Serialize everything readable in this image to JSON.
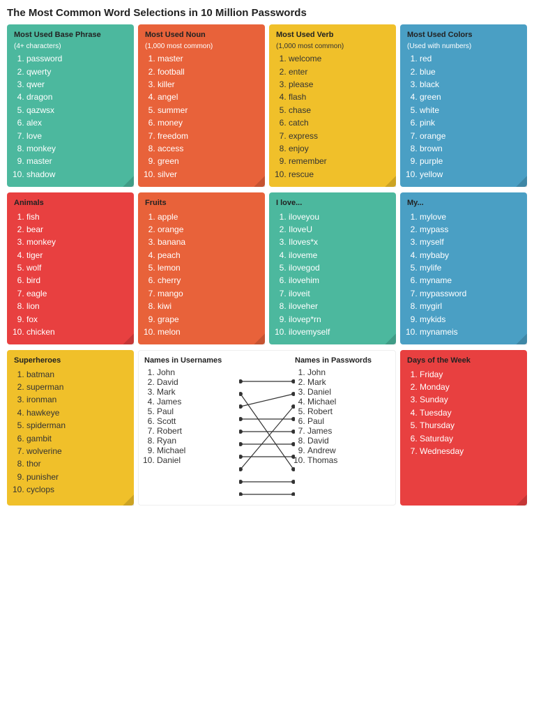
{
  "title": "The Most Common Word Selections in 10 Million Passwords",
  "sections": {
    "basePhrase": {
      "title": "Most Used Base Phrase",
      "subtitle": "(4+ characters)",
      "color": "green",
      "items": [
        "password",
        "qwerty",
        "qwer",
        "dragon",
        "qazwsx",
        "alex",
        "love",
        "monkey",
        "master",
        "shadow"
      ]
    },
    "noun": {
      "title": "Most Used Noun",
      "subtitle": "(1,000 most common)",
      "color": "orange-red",
      "items": [
        "master",
        "football",
        "killer",
        "angel",
        "summer",
        "money",
        "freedom",
        "access",
        "green",
        "silver"
      ]
    },
    "verb": {
      "title": "Most Used Verb",
      "subtitle": "(1,000 most common)",
      "color": "yellow",
      "items": [
        "welcome",
        "enter",
        "please",
        "flash",
        "chase",
        "catch",
        "express",
        "enjoy",
        "remember",
        "rescue"
      ]
    },
    "colors": {
      "title": "Most Used Colors",
      "subtitle": "(Used with numbers)",
      "color": "blue",
      "items": [
        "red",
        "blue",
        "black",
        "green",
        "white",
        "pink",
        "orange",
        "brown",
        "purple",
        "yellow"
      ]
    },
    "animals": {
      "title": "Animals",
      "color": "red",
      "items": [
        "fish",
        "bear",
        "monkey",
        "tiger",
        "wolf",
        "bird",
        "eagle",
        "lion",
        "fox",
        "chicken"
      ]
    },
    "fruits": {
      "title": "Fruits",
      "color": "orange-red",
      "items": [
        "apple",
        "orange",
        "banana",
        "peach",
        "lemon",
        "cherry",
        "mango",
        "kiwi",
        "grape",
        "melon"
      ]
    },
    "iLove": {
      "title": "I love...",
      "color": "green",
      "items": [
        "iloveyou",
        "IloveU",
        "Iloves*x",
        "iloveme",
        "ilovegod",
        "ilovehim",
        "iloveit",
        "iloveher",
        "ilovep*rn",
        "ilovemyself"
      ]
    },
    "my": {
      "title": "My...",
      "color": "blue",
      "items": [
        "mylove",
        "mypass",
        "myself",
        "mybaby",
        "mylife",
        "myname",
        "mypassword",
        "mygirl",
        "mykids",
        "mynameis"
      ]
    },
    "superheroes": {
      "title": "Superheroes",
      "color": "yellow",
      "items": [
        "batman",
        "superman",
        "ironman",
        "hawkeye",
        "spiderman",
        "gambit",
        "wolverine",
        "thor",
        "punisher",
        "cyclops"
      ]
    },
    "namesUsernames": {
      "title": "Names in Usernames",
      "items": [
        "John",
        "David",
        "Mark",
        "James",
        "Paul",
        "Scott",
        "Robert",
        "Ryan",
        "Michael",
        "Daniel"
      ]
    },
    "namesPasswords": {
      "title": "Names in Passwords",
      "items": [
        "John",
        "Mark",
        "Daniel",
        "Michael",
        "Robert",
        "Paul",
        "James",
        "David",
        "Andrew",
        "Thomas"
      ]
    },
    "daysOfWeek": {
      "title": "Days of the Week",
      "color": "red",
      "items": [
        "Friday",
        "Monday",
        "Sunday",
        "Tuesday",
        "Thursday",
        "Saturday",
        "Wednesday"
      ]
    }
  },
  "connectorLines": [
    {
      "from": 0,
      "to": 0
    },
    {
      "from": 1,
      "to": 7
    },
    {
      "from": 2,
      "to": 1
    },
    {
      "from": 3,
      "to": 3
    },
    {
      "from": 4,
      "to": 4
    },
    {
      "from": 5,
      "to": 5
    },
    {
      "from": 6,
      "to": 6
    },
    {
      "from": 7,
      "to": 2
    },
    {
      "from": 8,
      "to": 8
    },
    {
      "from": 9,
      "to": 9
    }
  ]
}
